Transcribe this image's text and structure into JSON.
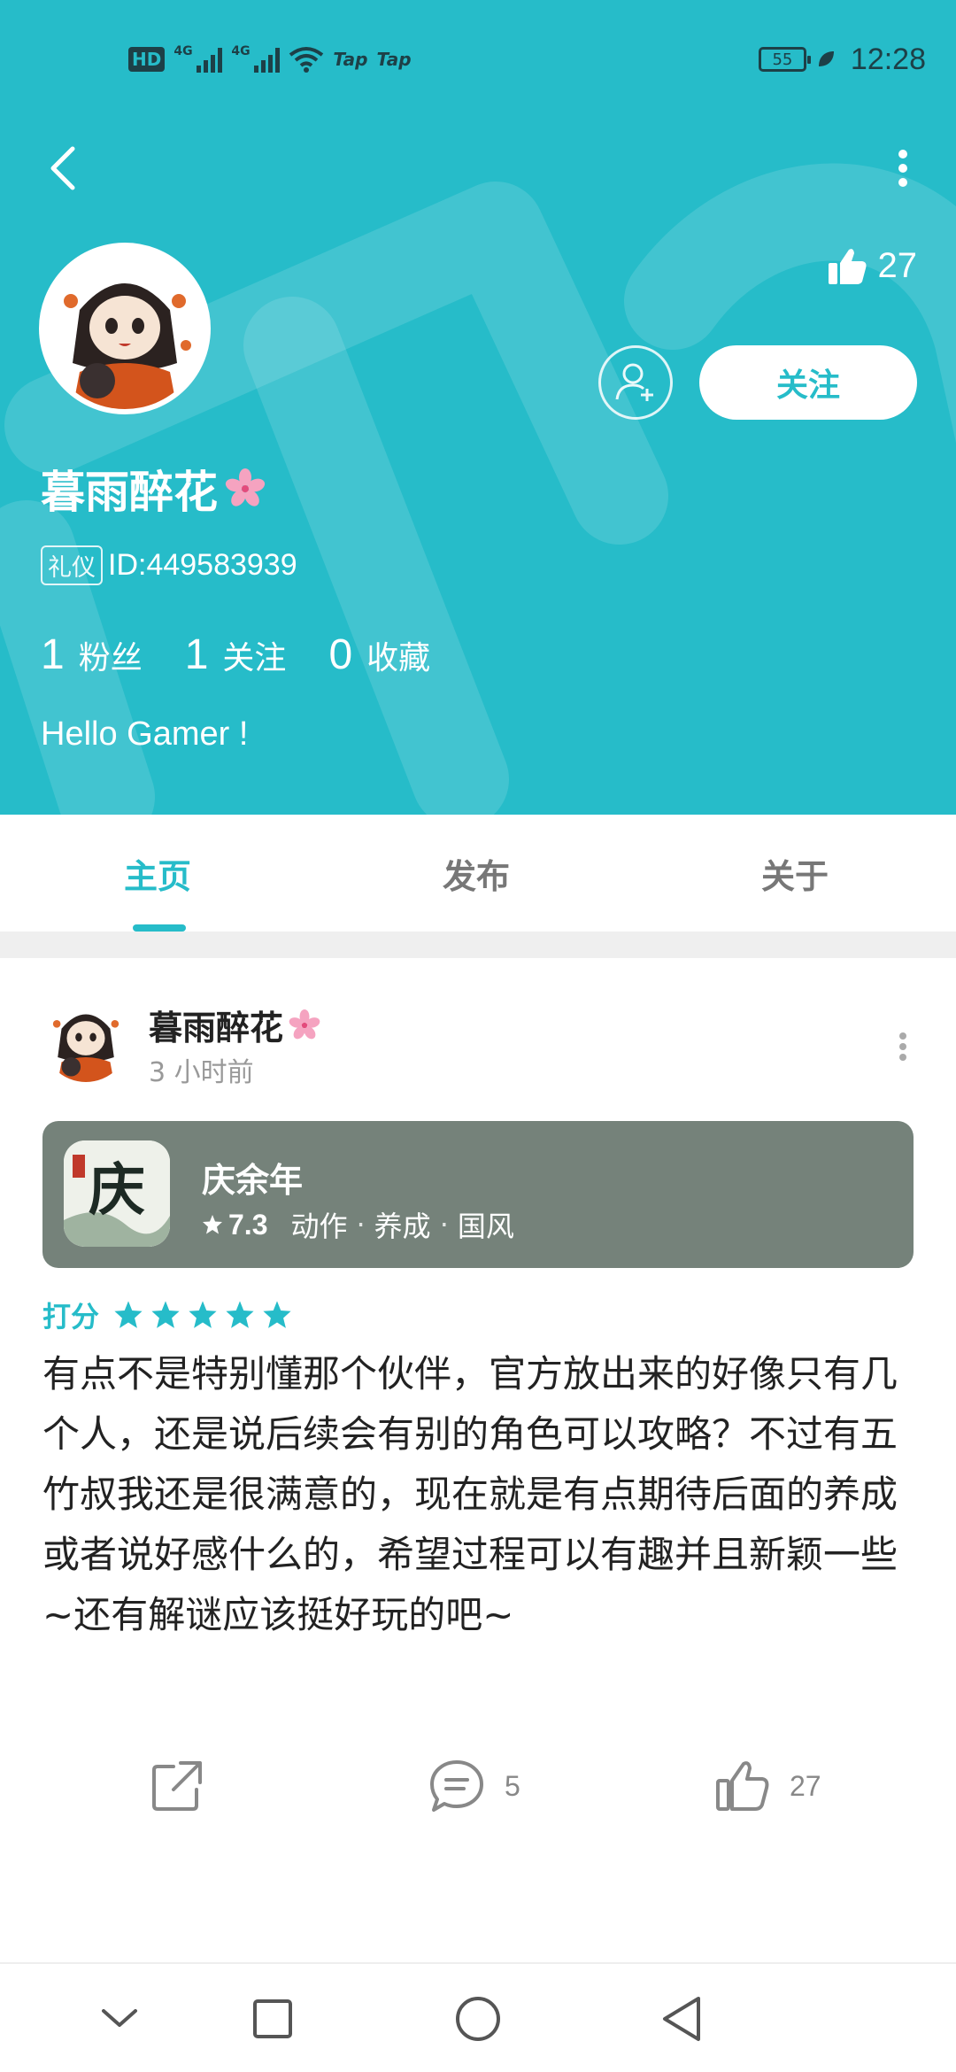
{
  "status_bar": {
    "hd": "HD",
    "sim1_tag": "4G",
    "sim2_tag": "4G",
    "app_icon_1": "Tap",
    "app_icon_2": "Tap",
    "battery": "55",
    "time": "12:28"
  },
  "header": {
    "likes_count": "27",
    "follow_label": "关注",
    "username": "暮雨醉花",
    "id_badge": "礼仪",
    "id_text": "ID:449583939",
    "bio": "Hello Gamer !",
    "stats": [
      {
        "num": "1",
        "label": "粉丝"
      },
      {
        "num": "1",
        "label": "关注"
      },
      {
        "num": "0",
        "label": "收藏"
      }
    ]
  },
  "tabs": [
    {
      "label": "主页",
      "active": true
    },
    {
      "label": "发布",
      "active": false
    },
    {
      "label": "关于",
      "active": false
    }
  ],
  "post": {
    "author": "暮雨醉花",
    "time": "3 小时前",
    "game": {
      "name": "庆余年",
      "rating": "7.3",
      "tags": [
        "动作",
        "养成",
        "国风"
      ],
      "icon_text": "庆"
    },
    "score_label": "打分",
    "stars": 5,
    "body": "有点不是特别懂那个伙伴，官方放出来的好像只有几个人，还是说后续会有别的角色可以攻略？不过有五竹叔我还是很满意的，现在就是有点期待后面的养成或者说好感什么的，希望过程可以有趣并且新颖一些~还有解谜应该挺好玩的吧~",
    "comments": "5",
    "likes": "27"
  },
  "colors": {
    "accent": "#26bcc9",
    "card_bg": "#75827a"
  }
}
